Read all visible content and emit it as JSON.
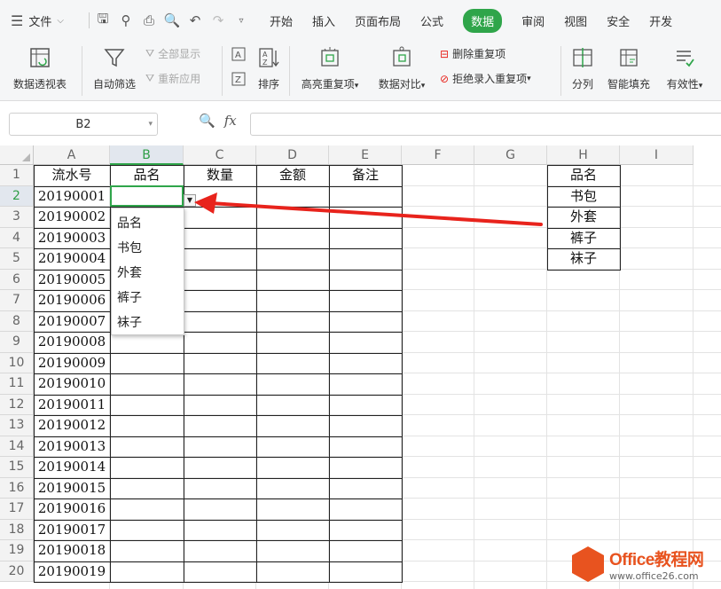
{
  "menubar": {
    "file_label": "文件",
    "tabs": [
      "开始",
      "插入",
      "页面布局",
      "公式",
      "数据",
      "审阅",
      "视图",
      "安全",
      "开发"
    ],
    "active_tab": "数据"
  },
  "ribbon": {
    "pivot": "数据透视表",
    "autofilter": "自动筛选",
    "show_all": "全部显示",
    "reapply": "重新应用",
    "sort": "排序",
    "highlight_dup": "高亮重复项",
    "compare": "数据对比",
    "remove_dup": "删除重复项",
    "reject_dup": "拒绝录入重复项",
    "split": "分列",
    "smart_fill": "智能填充",
    "validity": "有效性"
  },
  "formula_bar": {
    "name_box": "B2",
    "fx": "fx",
    "formula": ""
  },
  "columns": [
    "A",
    "B",
    "C",
    "D",
    "E",
    "F",
    "G",
    "H",
    "I"
  ],
  "rows": [
    "1",
    "2",
    "3",
    "4",
    "5",
    "6",
    "7",
    "8",
    "9",
    "10",
    "11",
    "12",
    "13",
    "14",
    "15",
    "16",
    "17",
    "18",
    "19",
    "20"
  ],
  "headers": {
    "A": "流水号",
    "B": "品名",
    "C": "数量",
    "D": "金额",
    "E": "备注"
  },
  "serials": [
    "20190001",
    "20190002",
    "20190003",
    "20190004",
    "20190005",
    "20190006",
    "20190007",
    "20190008",
    "20190009",
    "20190010",
    "20190011",
    "20190012",
    "20190013",
    "20190014",
    "20190015",
    "20190016",
    "20190017",
    "20190018",
    "20190019"
  ],
  "source_list": {
    "header": "品名",
    "items": [
      "书包",
      "外套",
      "裤子",
      "袜子"
    ]
  },
  "dropdown": {
    "options": [
      "品名",
      "书包",
      "外套",
      "裤子",
      "袜子"
    ]
  },
  "watermark": {
    "brand": "Office教程网",
    "url": "www.office26.com"
  },
  "colors": {
    "accent": "#2fa54a",
    "arrow": "#e8231c",
    "brand": "#e8531f"
  }
}
